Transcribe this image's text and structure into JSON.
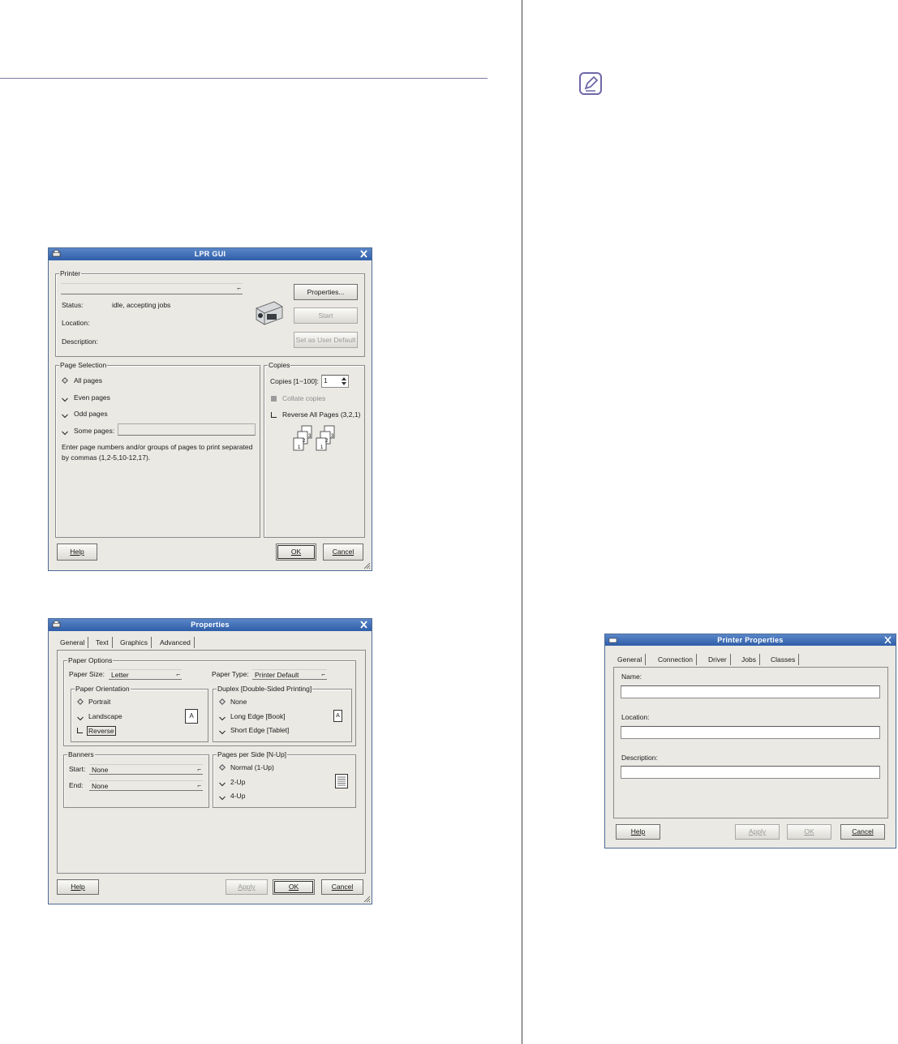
{
  "lpr_gui": {
    "title": "LPR GUI",
    "printer_legend": "Printer",
    "status_label": "Status:",
    "status_value": "idle, accepting jobs",
    "location_label": "Location:",
    "description_label": "Description:",
    "btn_properties": "Properties...",
    "btn_start": "Start",
    "btn_set_default": "Set as User Default",
    "page_selection_legend": "Page Selection",
    "radio_all": "All pages",
    "radio_even": "Even pages",
    "radio_odd": "Odd pages",
    "radio_some": "Some pages:",
    "hint_line1": "Enter page numbers and/or groups of pages to print separated",
    "hint_line2": "by commas (1,2-5,10-12,17).",
    "copies_legend": "Copies",
    "copies_label": "Copies [1~100]:",
    "copies_value": "1",
    "collate_label": "Collate copies",
    "reverse_label": "Reverse All Pages (3,2,1)",
    "btn_help": "Help",
    "btn_ok": "OK",
    "btn_cancel": "Cancel"
  },
  "properties": {
    "title": "Properties",
    "tabs": [
      "General",
      "Text",
      "Graphics",
      "Advanced"
    ],
    "paper_options_legend": "Paper Options",
    "paper_size_label": "Paper Size:",
    "paper_size_value": "Letter",
    "paper_type_label": "Paper Type:",
    "paper_type_value": "Printer Default",
    "orientation_legend": "Paper Orientation",
    "orient_portrait": "Portrait",
    "orient_landscape": "Landscape",
    "orient_reverse": "Reverse",
    "duplex_legend": "Duplex [Double-Sided Printing]",
    "duplex_none": "None",
    "duplex_long": "Long Edge [Book]",
    "duplex_short": "Short Edge [Tablet]",
    "banners_legend": "Banners",
    "start_label": "Start:",
    "start_value": "None",
    "end_label": "End:",
    "end_value": "None",
    "nup_legend": "Pages per Side [N-Up]",
    "nup_1": "Normal (1-Up)",
    "nup_2": "2-Up",
    "nup_4": "4-Up",
    "btn_help": "Help",
    "btn_apply": "Apply",
    "btn_ok": "OK",
    "btn_cancel": "Cancel"
  },
  "printer_properties": {
    "title": "Printer Properties",
    "tabs": [
      "General",
      "Connection",
      "Driver",
      "Jobs",
      "Classes"
    ],
    "name_label": "Name:",
    "location_label": "Location:",
    "description_label": "Description:",
    "btn_help": "Help",
    "btn_apply": "Apply",
    "btn_ok": "OK",
    "btn_cancel": "Cancel"
  }
}
